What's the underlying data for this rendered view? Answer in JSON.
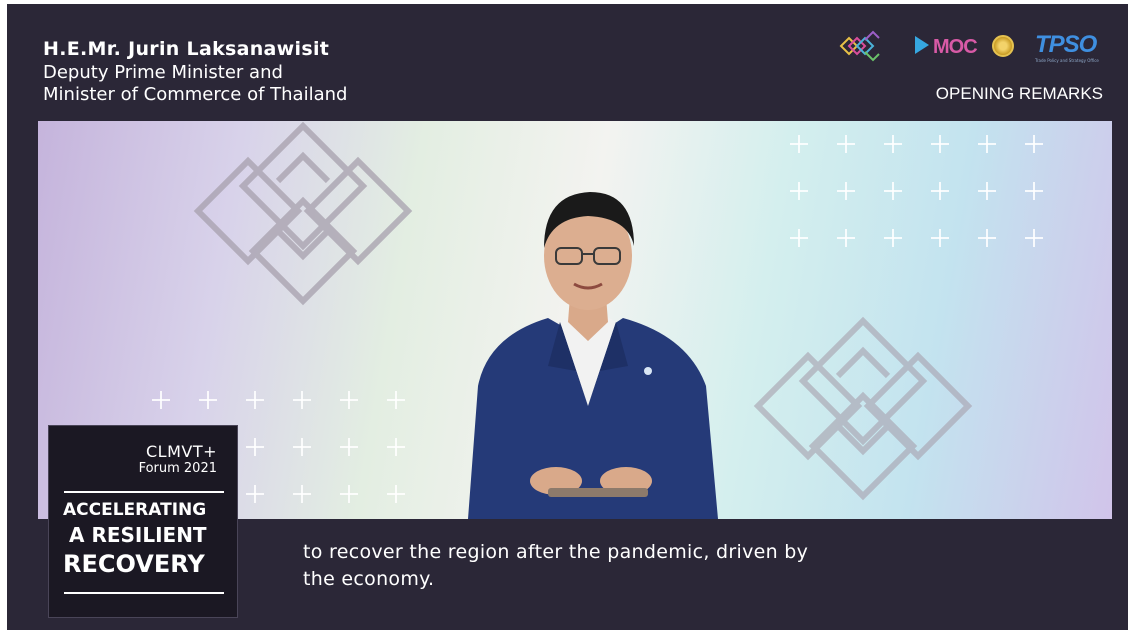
{
  "speaker": {
    "name": "H.E.Mr. Jurin Laksanawisit",
    "title": "Deputy Prime Minister and\nMinister of Commerce of Thailand"
  },
  "header": {
    "section_label": "OPENING REMARKS",
    "logos": {
      "moc": "MOC",
      "tpso": "TPSO",
      "tpso_sub": "Trade Policy and Strategy Office",
      "icons": [
        "knot-logo-icon",
        "moc-logo-icon",
        "government-seal-icon",
        "tpso-logo-icon"
      ]
    }
  },
  "badge": {
    "event": "CLMVT+",
    "forum": "Forum 2021",
    "line1": "ACCELERATING",
    "line2": "A RESILIENT",
    "line3": "RECOVERY"
  },
  "subtitle": {
    "text": "to recover the region after the pandemic, driven by\nthe economy."
  },
  "colors": {
    "background": "#2b2737",
    "badge_bg": "#1b1823",
    "text": "#ffffff"
  }
}
